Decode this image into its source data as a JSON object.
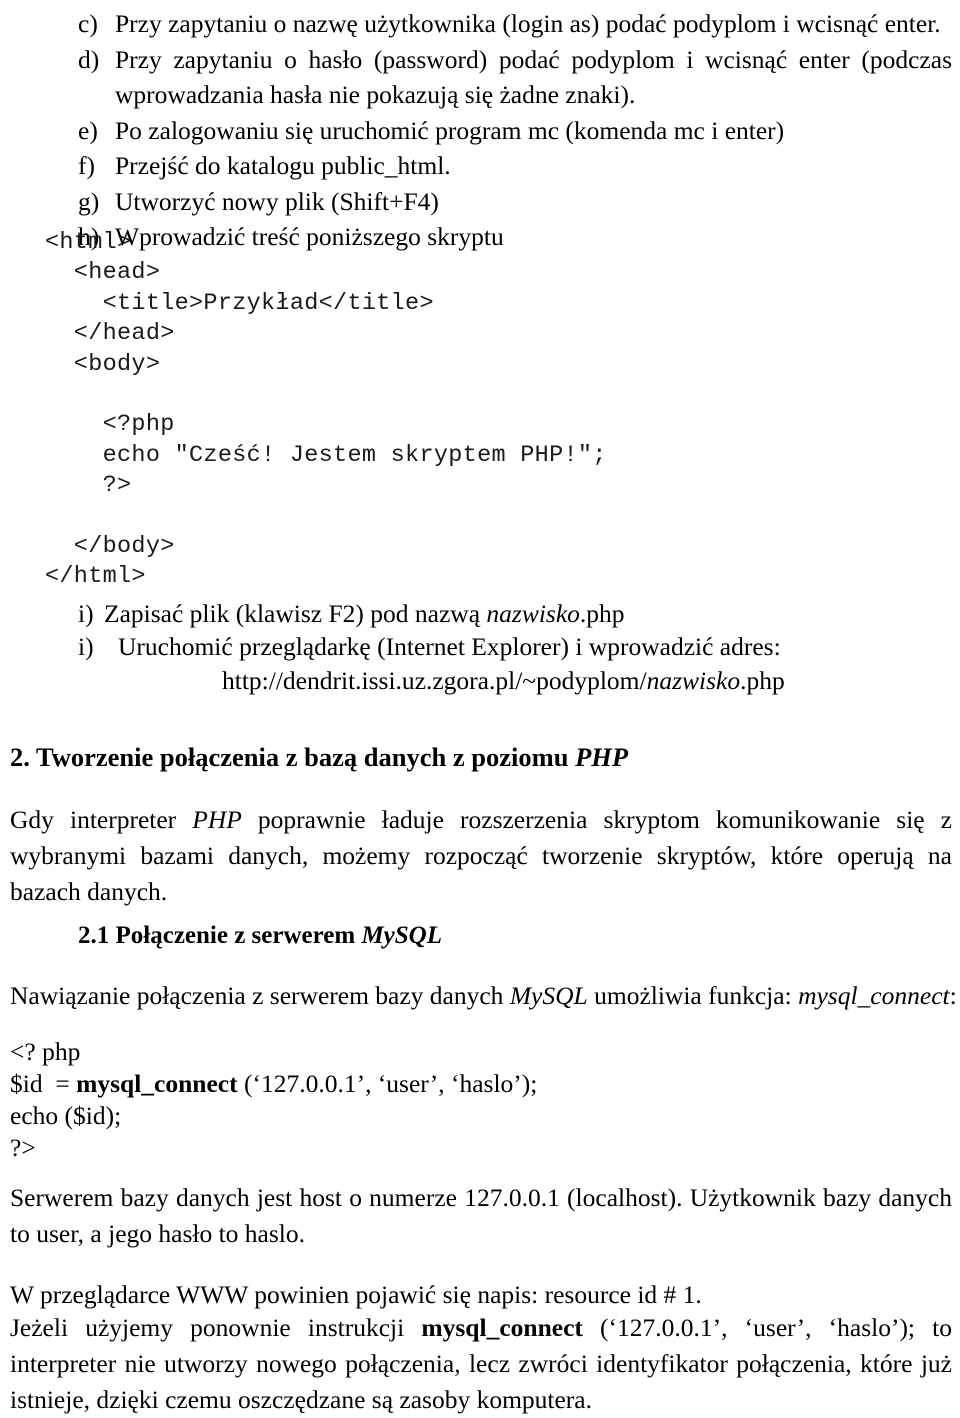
{
  "document": {
    "language": "pl",
    "steps_list": {
      "items": [
        {
          "marker": "c)",
          "text": "Przy zapytaniu o nazwę użytkownika (login as) podać podyplom i wcisnąć enter."
        },
        {
          "marker": "d)",
          "text": "Przy zapytaniu o hasło (password) podać podyplom i wcisnąć enter (podczas wprowadzania hasła nie pokazują się żadne znaki)."
        },
        {
          "marker": "e)",
          "text": "Po zalogowaniu się uruchomić program mc (komenda mc i enter)"
        },
        {
          "marker": "f)",
          "text": "Przejść do katalogu public_html."
        },
        {
          "marker": "g)",
          "text": "Utworzyć nowy plik (Shift+F4)"
        },
        {
          "marker": "h)",
          "text": "Wprowadzić treść poniższego skryptu"
        }
      ]
    },
    "code_block_html": "<html>\n  <head>\n    <title>Przykład</title>\n  </head>\n  <body>\n\n    <?php\n    echo \"Cześć! Jestem skryptem PHP!\";\n    ?>\n\n  </body>\n</html>",
    "roman_list": {
      "item_1_marker": "i)",
      "item_1_text_before": "Zapisać plik (klawisz F2) pod nazwą ",
      "item_1_italic": "nazwisko",
      "item_1_text_after": ".php",
      "item_2_marker": "i)",
      "item_2_text": "Uruchomić przeglądarkę (Internet Explorer) i wprowadzić adres:",
      "url_before": "http://dendrit.issi.uz.zgora.pl/~podyplom/",
      "url_italic": "nazwisko",
      "url_after": ".php"
    },
    "section2": {
      "number": "2.",
      "title_plain": " Tworzenie połączenia z bazą danych z poziomu ",
      "title_italic": "PHP",
      "intro_before": "Gdy interpreter ",
      "intro_italic": "PHP",
      "intro_after": " poprawnie ładuje rozszerzenia skryptom komunikowanie się z wybranymi bazami danych, możemy rozpocząć tworzenie skryptów, które operują na bazach danych."
    },
    "section21": {
      "number": "2.1",
      "title_plain": " Połączenie z serwerem ",
      "title_italic": "MySQL",
      "lead_before": "Nawiązanie połączenia z serwerem bazy danych ",
      "lead_italic_1": "MySQL",
      "lead_middle": " umożliwia funkcja: ",
      "lead_italic_2": "mysql_connect",
      "lead_after": ":"
    },
    "php_snippet": {
      "line_1": "<? php",
      "line_2_prefix": "$id  = ",
      "line_2_function": "mysql_connect",
      "line_2_suffix": " (‘127.0.0.1’, ‘user’, ‘haslo’);",
      "line_3": "echo ($id);",
      "line_4": "?>"
    },
    "closing": {
      "server_paragraph": "Serwerem bazy danych jest host o numerze 127.0.0.1 (localhost). Użytkownik bazy danych to user,  a jego hasło to haslo.",
      "browser_paragraph": "W przeglądarce WWW powinien pojawić się napis: resource id # 1.",
      "jezeli_before": "Jeżeli użyjemy ponownie instrukcji ",
      "jezeli_bold": "mysql_connect",
      "jezeli_after": " (‘127.0.0.1’, ‘user’, ‘haslo’); to interpreter nie utworzy nowego połączenia, lecz zwróci identyfikator połączenia, które już istnieje, dzięki czemu oszczędzane są zasoby komputera."
    }
  }
}
